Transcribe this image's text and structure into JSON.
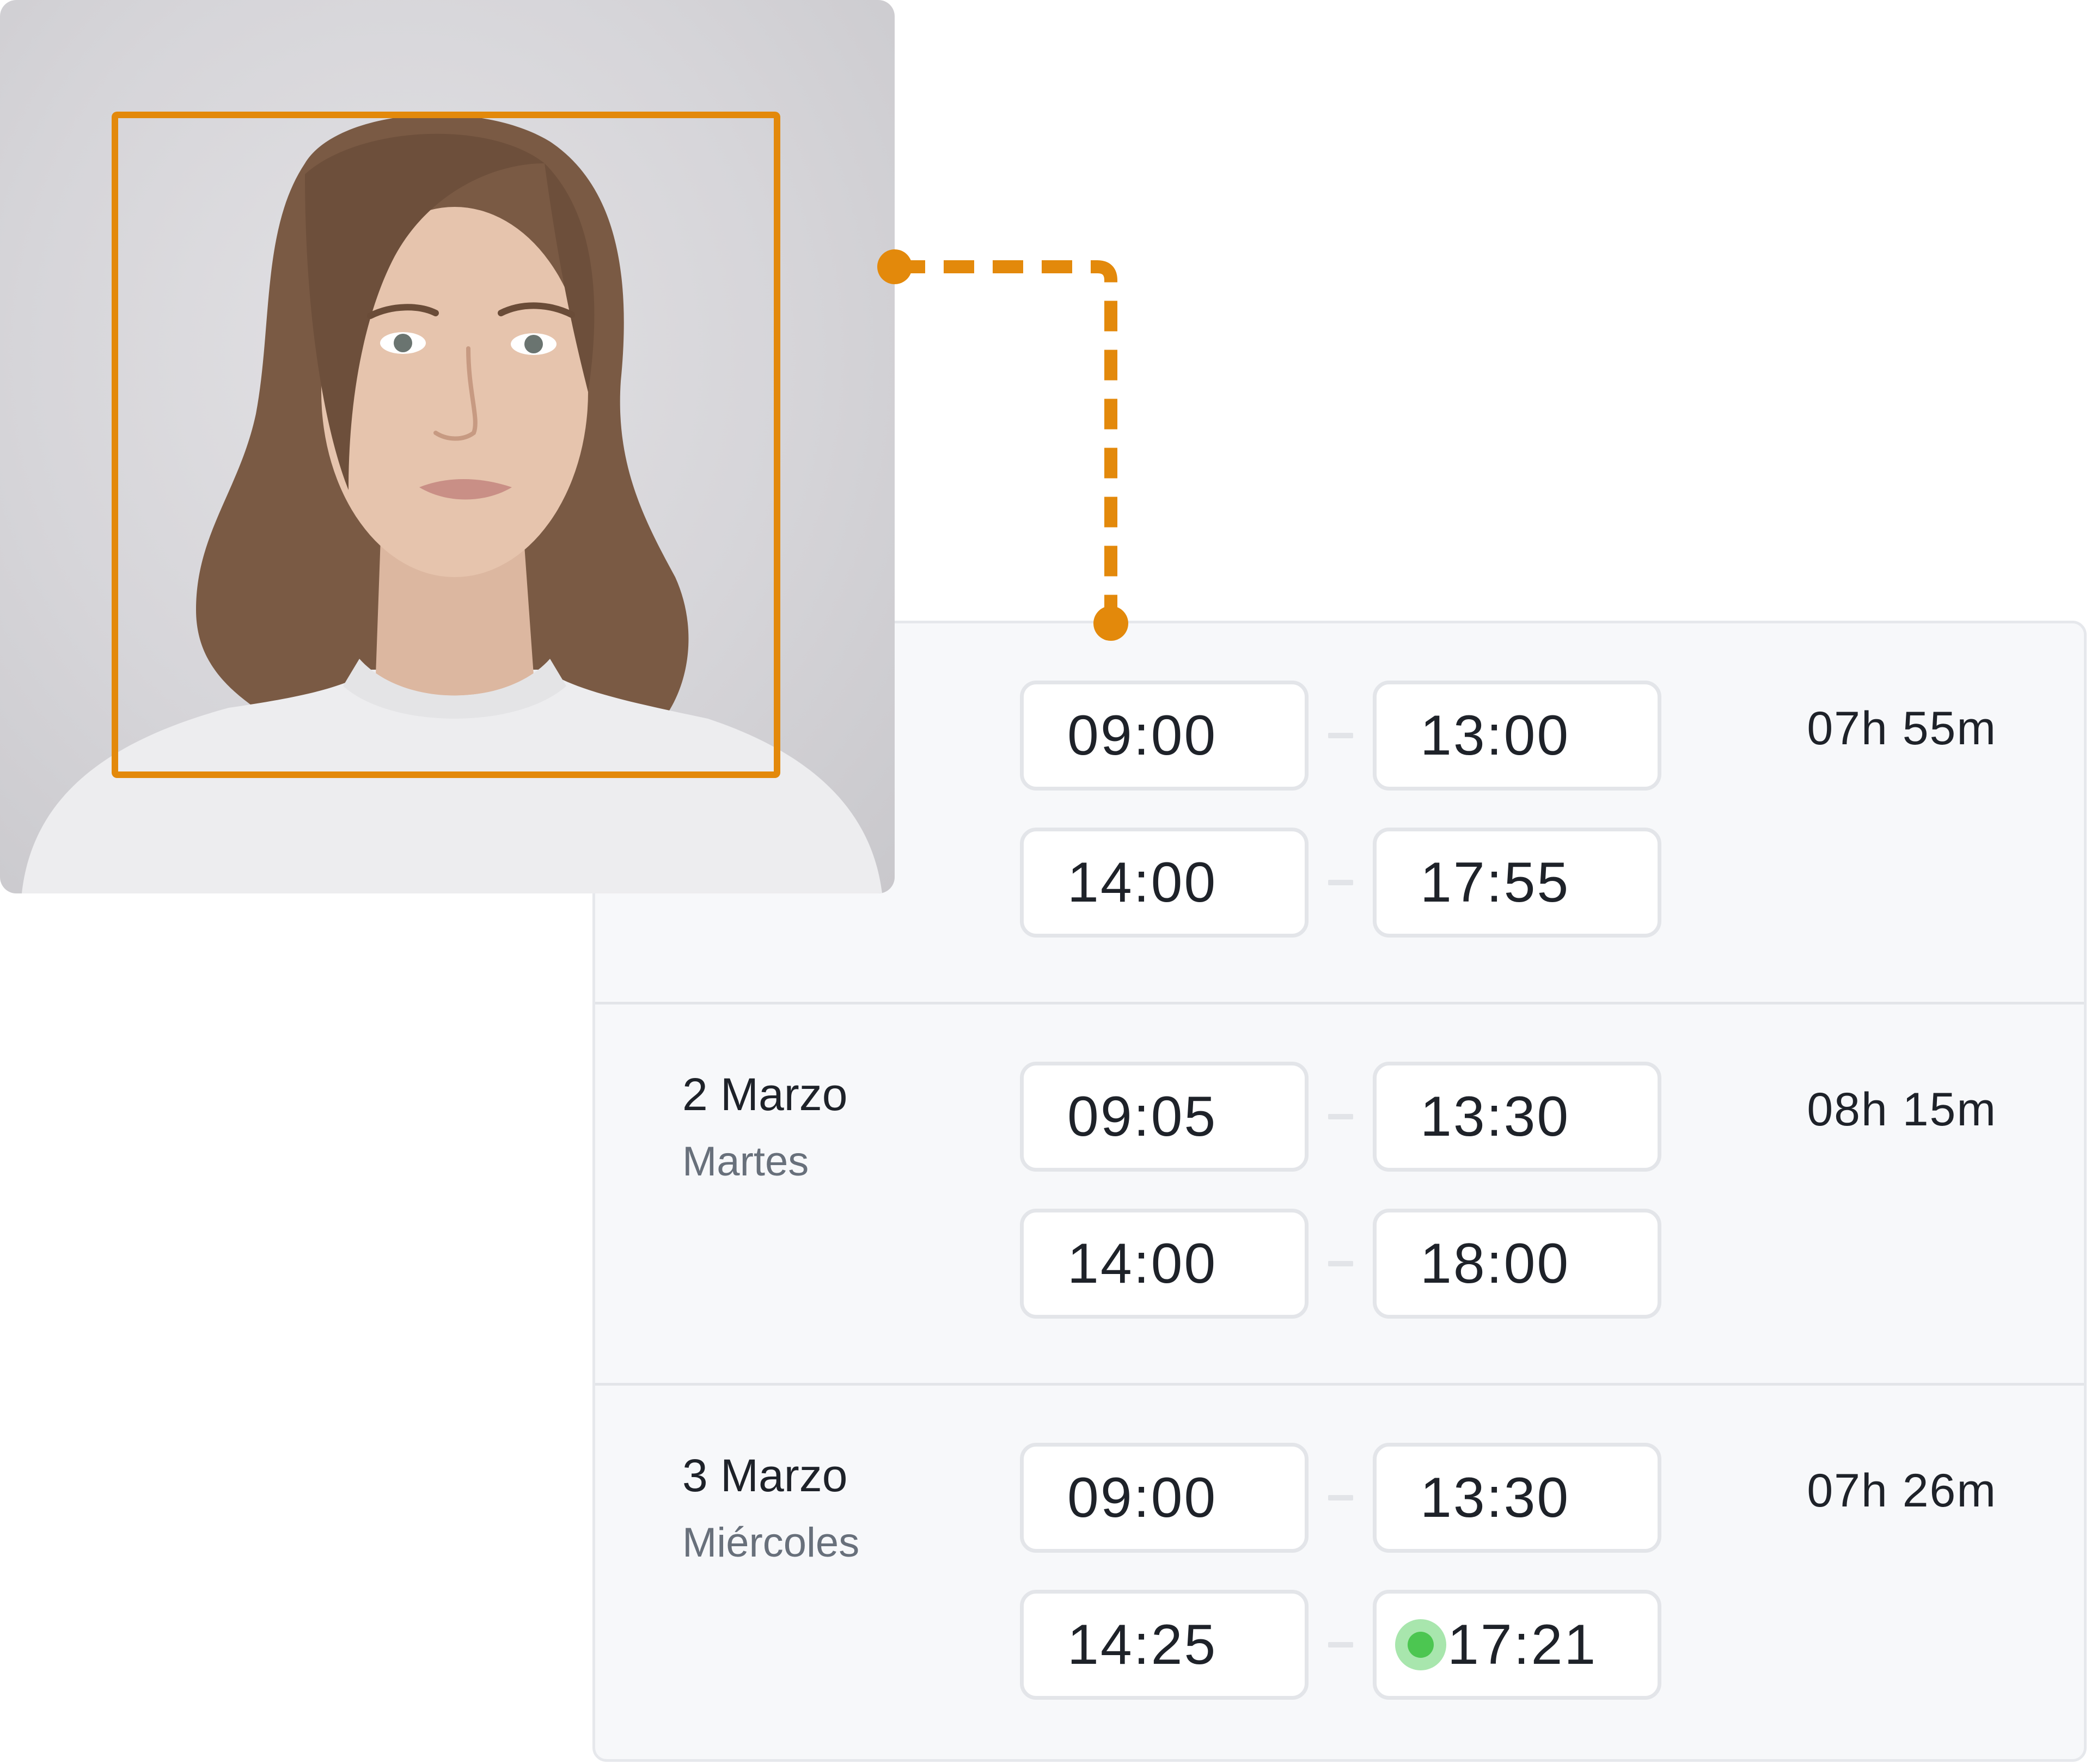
{
  "colors": {
    "accent": "#e3890b",
    "live": "#4cc651",
    "card_bg": "#f7f8fa",
    "border": "#e3e5e9",
    "text": "#1e2229",
    "muted": "#68707b"
  },
  "photo": {
    "subject": "portrait-photo",
    "frame_icon": "face-detection-frame"
  },
  "days": [
    {
      "date": "",
      "weekday": "",
      "total": "07h 55m",
      "entries": [
        {
          "start": "09:00",
          "end": "13:00"
        },
        {
          "start": "14:00",
          "end": "17:55"
        }
      ]
    },
    {
      "date": "2 Marzo",
      "weekday": "Martes",
      "total": "08h 15m",
      "entries": [
        {
          "start": "09:05",
          "end": "13:30"
        },
        {
          "start": "14:00",
          "end": "18:00"
        }
      ]
    },
    {
      "date": "3 Marzo",
      "weekday": "Miércoles",
      "total": "07h 26m",
      "entries": [
        {
          "start": "09:00",
          "end": "13:30"
        },
        {
          "start": "14:25",
          "end": "17:21",
          "live": true
        }
      ]
    }
  ]
}
